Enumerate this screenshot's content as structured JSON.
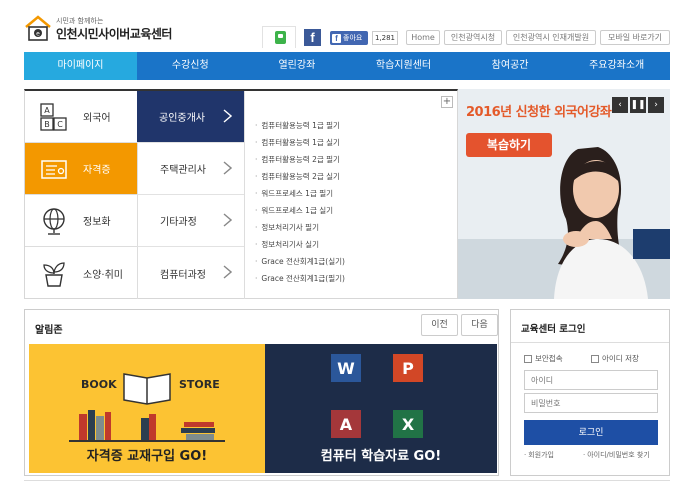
{
  "header": {
    "logo_sub": "시민과 함께하는",
    "logo_title": "인천시민사이버교육센터",
    "like_label": "좋아요",
    "like_count": "1,281",
    "links": [
      "Home",
      "인천광역시청",
      "인천광역시 인재개발원",
      "모바일 바로가기"
    ]
  },
  "gnb": [
    "마이페이지",
    "수강신청",
    "열린강좌",
    "학습지원센터",
    "참여공간",
    "주요강좌소개"
  ],
  "categories": [
    {
      "label": "외국어",
      "icon": "abc-blocks-icon"
    },
    {
      "label": "자격증",
      "icon": "certificate-icon"
    },
    {
      "label": "정보화",
      "icon": "globe-icon"
    },
    {
      "label": "소양·취미",
      "icon": "plant-pot-icon"
    }
  ],
  "subcategories": [
    "공인중개사",
    "주택관리사",
    "기타과정",
    "컴퓨터과정"
  ],
  "courses": [
    "컴퓨터활용능력 1급 필기",
    "컴퓨터활용능력 1급 실기",
    "컴퓨터활용능력 2급 필기",
    "컴퓨터활용능력 2급 실기",
    "워드프로세스 1급 필기",
    "워드프로세스 1급 실기",
    "정보처리기사 필기",
    "정보처리기사 실기",
    "Grace 전산회계1급(실기)",
    "Grace 전산회계1급(필기)"
  ],
  "banner": {
    "title": "2016년 신청한 외국어강좌",
    "button": "복습하기"
  },
  "zone": {
    "title": "알림존",
    "prev": "이전",
    "next": "다음",
    "left_caption": "자격증 교재구입 GO!",
    "left_sign_book": "BOOK",
    "left_sign_store": "STORE",
    "right_caption": "컴퓨터 학습자료 GO!"
  },
  "login": {
    "title": "교육센터 로그인",
    "secure": "보안접속",
    "save_id": "아이디 저장",
    "id_placeholder": "아이디",
    "pw_placeholder": "비밀번호",
    "button": "로그인",
    "join": "회원가입",
    "find": "아이디/비밀번호 찾기"
  },
  "colors": {
    "gnb": "#1a74c8",
    "gnb_active": "#26a9df",
    "cat_active": "#f39800",
    "sub_active": "#20356b",
    "banner_accent": "#e4532e"
  }
}
